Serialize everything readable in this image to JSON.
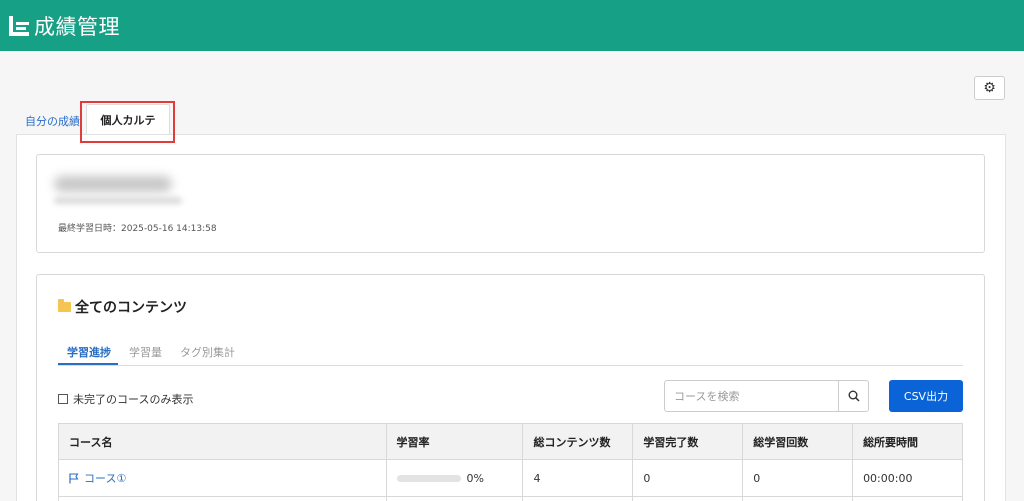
{
  "header": {
    "title": "成績管理",
    "logo_icon": "logo-icon",
    "background": "#16a085"
  },
  "toolbar": {
    "settings_icon": "gear-icon"
  },
  "tabs": [
    {
      "label": "自分の成績",
      "active": false
    },
    {
      "label": "個人カルテ",
      "active": true
    }
  ],
  "profile": {
    "last_study": "最終学習日時：2025-05-16 14:13:58"
  },
  "content": {
    "section_title": "全てのコンテンツ",
    "subtabs": [
      {
        "label": "学習進捗",
        "active": true
      },
      {
        "label": "学習量",
        "active": false
      },
      {
        "label": "タグ別集計",
        "active": false
      }
    ],
    "filter_label": "未完了のコースのみ表示",
    "search": {
      "placeholder": "コースを検索",
      "value": ""
    },
    "csv_label": "CSV出力",
    "table": {
      "headers": [
        "コース名",
        "学習率",
        "総コンテンツ数",
        "学習完了数",
        "総学習回数",
        "総所要時間"
      ],
      "rows": [
        {
          "course": "コース①",
          "progress_percent": 0,
          "progress_label": "0%",
          "total_contents": "4",
          "completed": "0",
          "attempts": "0",
          "duration": "00:00:00"
        }
      ]
    }
  },
  "colors": {
    "accent": "#2a6dc6",
    "primary_button": "#0a64d8",
    "highlight": "#e23b3b"
  }
}
